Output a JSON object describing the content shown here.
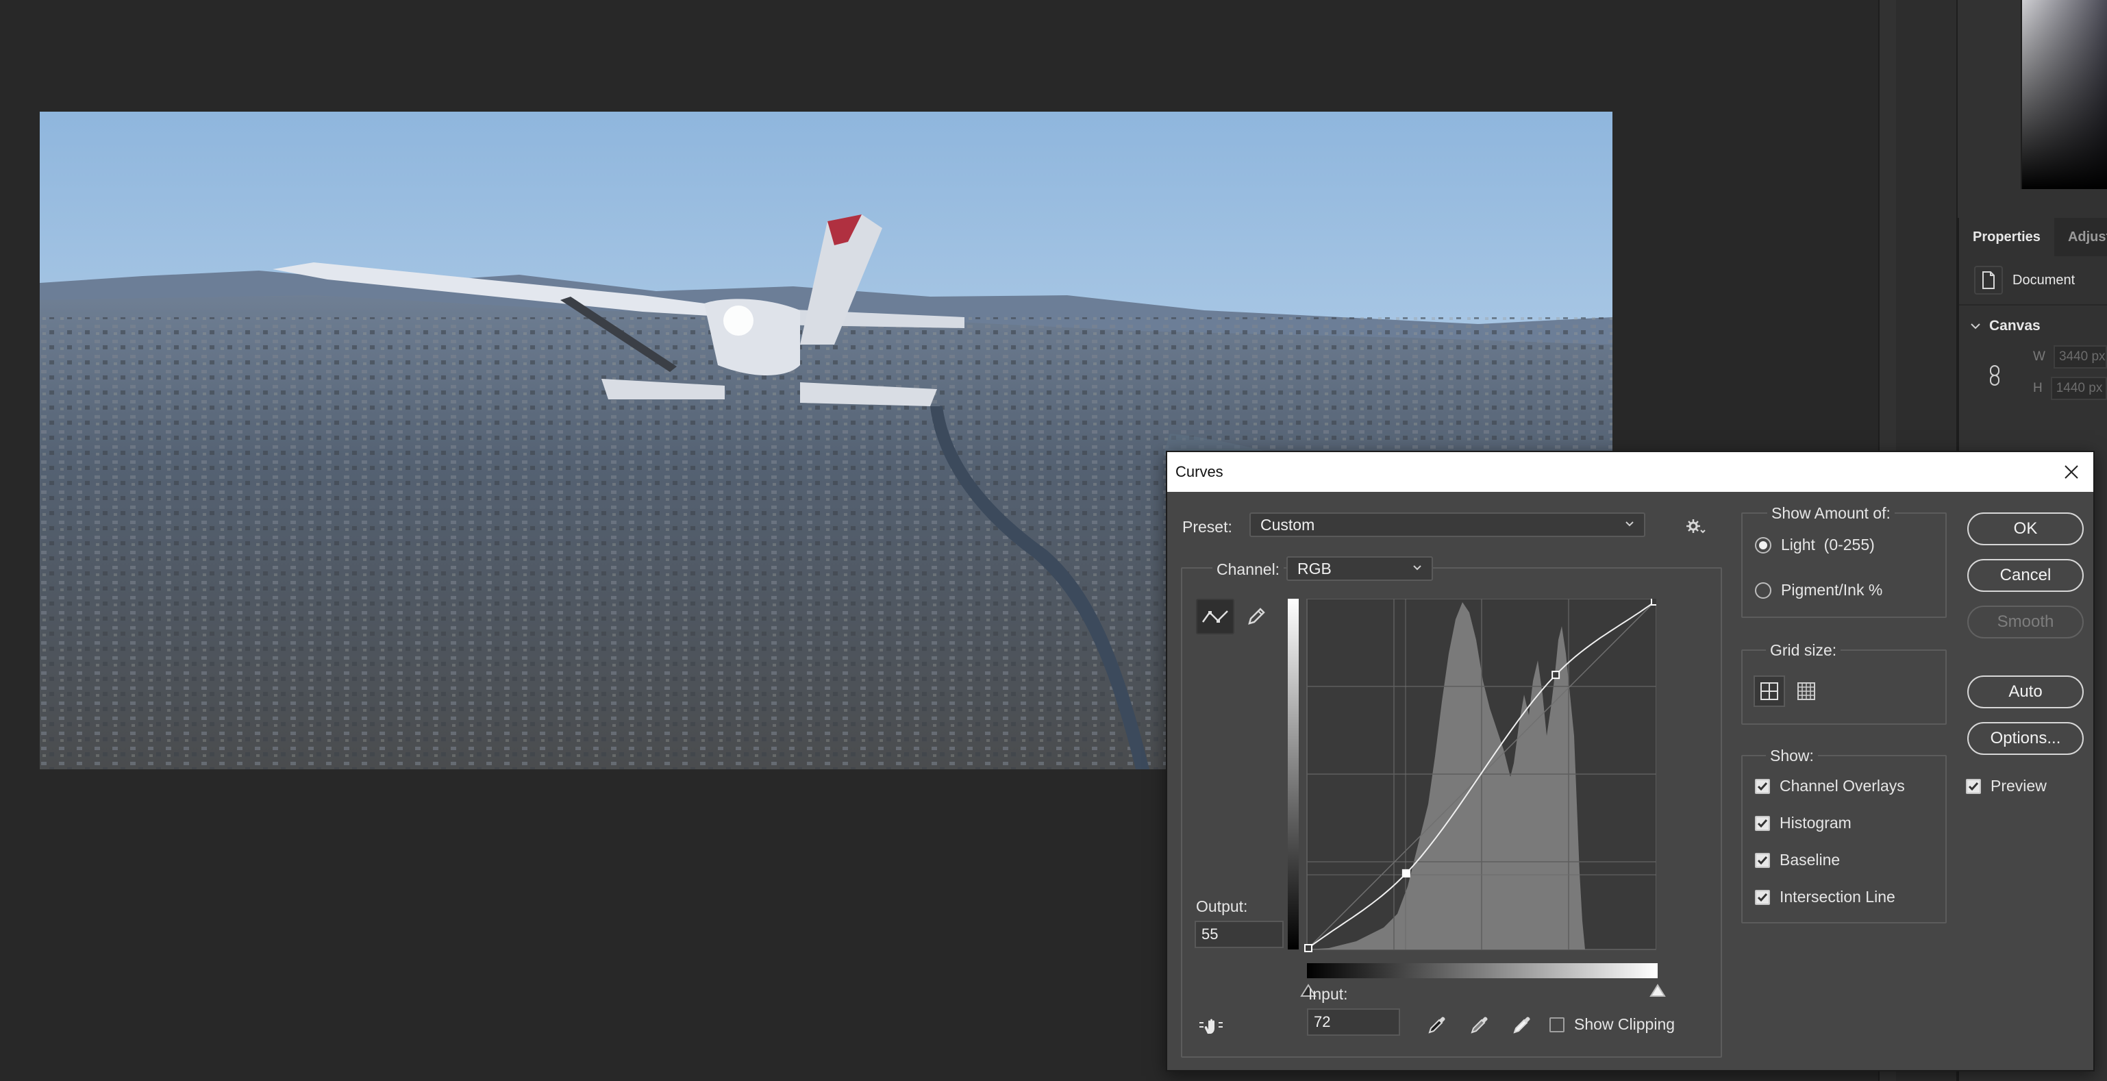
{
  "properties": {
    "tabs": [
      "Properties",
      "Adjustr"
    ],
    "document_label": "Document",
    "canvas_label": "Canvas",
    "width_label": "W",
    "width_value": "3440 px",
    "height_label": "H",
    "height_value": "1440 px"
  },
  "curves": {
    "title": "Curves",
    "preset_label": "Preset:",
    "preset_value": "Custom",
    "channel_label": "Channel:",
    "channel_value": "RGB",
    "output_label": "Output:",
    "output_value": "55",
    "input_label": "Input:",
    "input_value": "72",
    "show_clipping_label": "Show Clipping",
    "show_clipping_checked": false,
    "show_amount": {
      "title": "Show Amount of:",
      "light_label": "Light  (0-255)",
      "pigment_label": "Pigment/Ink %",
      "selected": "light"
    },
    "grid_size": {
      "title": "Grid size:",
      "selected": "simple"
    },
    "show": {
      "title": "Show:",
      "options": [
        {
          "label": "Channel Overlays",
          "checked": true
        },
        {
          "label": "Histogram",
          "checked": true
        },
        {
          "label": "Baseline",
          "checked": true
        },
        {
          "label": "Intersection Line",
          "checked": true
        }
      ]
    },
    "buttons": {
      "ok": "OK",
      "cancel": "Cancel",
      "smooth": "Smooth",
      "auto": "Auto",
      "options": "Options..."
    },
    "preview_label": "Preview",
    "preview_checked": true,
    "curve_points": [
      [
        0,
        0
      ],
      [
        72,
        55
      ],
      [
        182,
        201
      ],
      [
        255,
        255
      ]
    ],
    "accent_color": "#ffffff"
  }
}
